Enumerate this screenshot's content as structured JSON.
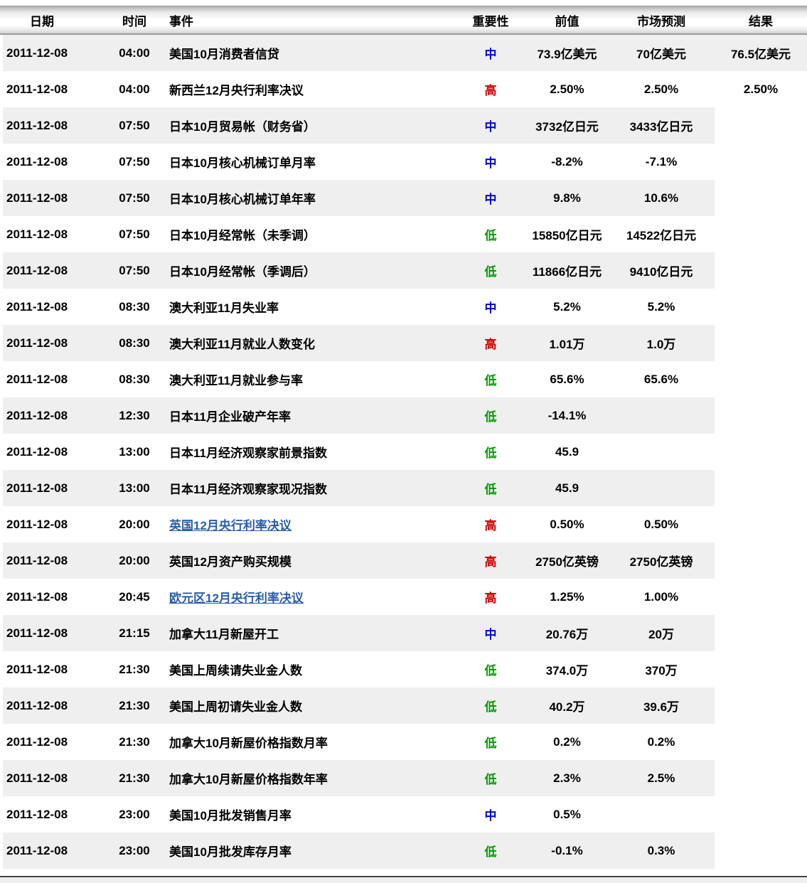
{
  "table": {
    "columns": [
      {
        "label": "日期"
      },
      {
        "label": "时间"
      },
      {
        "label": "事件"
      },
      {
        "label": "重要性"
      },
      {
        "label": "前值"
      },
      {
        "label": "市场预测"
      },
      {
        "label": "结果"
      }
    ],
    "rows": [
      {
        "date": "2011-12-08",
        "time": "04:00",
        "event": "美国10月消费者信贷",
        "event_link": false,
        "importance": "中",
        "level": "mid",
        "previous": "73.9亿美元",
        "forecast": "70亿美元",
        "result": "76.5亿美元"
      },
      {
        "date": "2011-12-08",
        "time": "04:00",
        "event": "新西兰12月央行利率决议",
        "event_link": false,
        "importance": "高",
        "level": "high",
        "previous": "2.50%",
        "forecast": "2.50%",
        "result": "2.50%"
      },
      {
        "date": "2011-12-08",
        "time": "07:50",
        "event": "日本10月贸易帐（财务省）",
        "event_link": false,
        "importance": "中",
        "level": "mid",
        "previous": "3732亿日元",
        "forecast": "3433亿日元",
        "result": ""
      },
      {
        "date": "2011-12-08",
        "time": "07:50",
        "event": "日本10月核心机械订单月率",
        "event_link": false,
        "importance": "中",
        "level": "mid",
        "previous": "-8.2%",
        "forecast": "-7.1%",
        "result": ""
      },
      {
        "date": "2011-12-08",
        "time": "07:50",
        "event": "日本10月核心机械订单年率",
        "event_link": false,
        "importance": "中",
        "level": "mid",
        "previous": "9.8%",
        "forecast": "10.6%",
        "result": ""
      },
      {
        "date": "2011-12-08",
        "time": "07:50",
        "event": "日本10月经常帐（未季调）",
        "event_link": false,
        "importance": "低",
        "level": "low",
        "previous": "15850亿日元",
        "forecast": "14522亿日元",
        "result": ""
      },
      {
        "date": "2011-12-08",
        "time": "07:50",
        "event": "日本10月经常帐（季调后）",
        "event_link": false,
        "importance": "低",
        "level": "low",
        "previous": "11866亿日元",
        "forecast": "9410亿日元",
        "result": ""
      },
      {
        "date": "2011-12-08",
        "time": "08:30",
        "event": "澳大利亚11月失业率",
        "event_link": false,
        "importance": "中",
        "level": "mid",
        "previous": "5.2%",
        "forecast": "5.2%",
        "result": ""
      },
      {
        "date": "2011-12-08",
        "time": "08:30",
        "event": "澳大利亚11月就业人数变化",
        "event_link": false,
        "importance": "高",
        "level": "high",
        "previous": "1.01万",
        "forecast": "1.0万",
        "result": ""
      },
      {
        "date": "2011-12-08",
        "time": "08:30",
        "event": "澳大利亚11月就业参与率",
        "event_link": false,
        "importance": "低",
        "level": "low",
        "previous": "65.6%",
        "forecast": "65.6%",
        "result": ""
      },
      {
        "date": "2011-12-08",
        "time": "12:30",
        "event": "日本11月企业破产年率",
        "event_link": false,
        "importance": "低",
        "level": "low",
        "previous": "-14.1%",
        "forecast": "",
        "result": ""
      },
      {
        "date": "2011-12-08",
        "time": "13:00",
        "event": "日本11月经济观察家前景指数",
        "event_link": false,
        "importance": "低",
        "level": "low",
        "previous": "45.9",
        "forecast": "",
        "result": ""
      },
      {
        "date": "2011-12-08",
        "time": "13:00",
        "event": "日本11月经济观察家现况指数",
        "event_link": false,
        "importance": "低",
        "level": "low",
        "previous": "45.9",
        "forecast": "",
        "result": ""
      },
      {
        "date": "2011-12-08",
        "time": "20:00",
        "event": "英国12月央行利率决议",
        "event_link": true,
        "importance": "高",
        "level": "high",
        "previous": "0.50%",
        "forecast": "0.50%",
        "result": ""
      },
      {
        "date": "2011-12-08",
        "time": "20:00",
        "event": "英国12月资产购买规模",
        "event_link": false,
        "importance": "高",
        "level": "high",
        "previous": "2750亿英镑",
        "forecast": "2750亿英镑",
        "result": ""
      },
      {
        "date": "2011-12-08",
        "time": "20:45",
        "event": "欧元区12月央行利率决议",
        "event_link": true,
        "importance": "高",
        "level": "high",
        "previous": "1.25%",
        "forecast": "1.00%",
        "result": ""
      },
      {
        "date": "2011-12-08",
        "time": "21:15",
        "event": "加拿大11月新屋开工",
        "event_link": false,
        "importance": "中",
        "level": "mid",
        "previous": "20.76万",
        "forecast": "20万",
        "result": ""
      },
      {
        "date": "2011-12-08",
        "time": "21:30",
        "event": "美国上周续请失业金人数",
        "event_link": false,
        "importance": "低",
        "level": "low",
        "previous": "374.0万",
        "forecast": "370万",
        "result": ""
      },
      {
        "date": "2011-12-08",
        "time": "21:30",
        "event": "美国上周初请失业金人数",
        "event_link": false,
        "importance": "低",
        "level": "low",
        "previous": "40.2万",
        "forecast": "39.6万",
        "result": ""
      },
      {
        "date": "2011-12-08",
        "time": "21:30",
        "event": "加拿大10月新屋价格指数月率",
        "event_link": false,
        "importance": "低",
        "level": "low",
        "previous": "0.2%",
        "forecast": "0.2%",
        "result": ""
      },
      {
        "date": "2011-12-08",
        "time": "21:30",
        "event": "加拿大10月新屋价格指数年率",
        "event_link": false,
        "importance": "低",
        "level": "low",
        "previous": "2.3%",
        "forecast": "2.5%",
        "result": ""
      },
      {
        "date": "2011-12-08",
        "time": "23:00",
        "event": "美国10月批发销售月率",
        "event_link": false,
        "importance": "中",
        "level": "mid",
        "previous": "0.5%",
        "forecast": "",
        "result": ""
      },
      {
        "date": "2011-12-08",
        "time": "23:00",
        "event": "美国10月批发库存月率",
        "event_link": false,
        "importance": "低",
        "level": "low",
        "previous": "-0.1%",
        "forecast": "0.3%",
        "result": ""
      }
    ]
  },
  "colors": {
    "importance_high": "#cc0000",
    "importance_mid": "#0000cc",
    "importance_low": "#009900",
    "link_blue": "#2a5da8",
    "stripe": "#efefef",
    "bottom_rule": "#444444"
  }
}
